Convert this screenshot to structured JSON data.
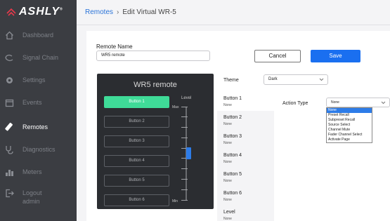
{
  "brand": {
    "name": "ASHLY",
    "reg": "®"
  },
  "sidebar": {
    "items": [
      {
        "label": "Dashboard",
        "icon": "home-icon"
      },
      {
        "label": "Signal Chain",
        "icon": "signal-chain-icon"
      },
      {
        "label": "Settings",
        "icon": "gear-icon"
      },
      {
        "label": "Events",
        "icon": "calendar-icon"
      },
      {
        "label": "Remotes",
        "icon": "remote-icon"
      },
      {
        "label": "Diagnostics",
        "icon": "stethoscope-icon"
      },
      {
        "label": "Meters",
        "icon": "meters-icon"
      },
      {
        "label": "Logout",
        "sub": "admin",
        "icon": "logout-icon"
      }
    ],
    "active": "Remotes"
  },
  "breadcrumb": {
    "parent": "Remotes",
    "separator": "›",
    "current": "Edit Virtual WR-5"
  },
  "form": {
    "remote_name_label": "Remote Name",
    "remote_name_value": "WR5 remote",
    "cancel_label": "Cancel",
    "save_label": "Save",
    "theme_label": "Theme",
    "theme_value": "Dark",
    "action_type_label": "Action Type",
    "action_type_value": "None"
  },
  "preview": {
    "title": "WR5 remote",
    "buttons": [
      "Button 1",
      "Button 2",
      "Button 3",
      "Button 4",
      "Button 5",
      "Button 6"
    ],
    "level_label": "Level",
    "max_label": "Max",
    "min_label": "Min",
    "fader_level": 0.5
  },
  "button_list": [
    {
      "name": "Button 1",
      "action": "None"
    },
    {
      "name": "Button 2",
      "action": "None"
    },
    {
      "name": "Button 3",
      "action": "None"
    },
    {
      "name": "Button 4",
      "action": "None"
    },
    {
      "name": "Button 5",
      "action": "None"
    },
    {
      "name": "Button 6",
      "action": "None"
    },
    {
      "name": "Level",
      "action": "None"
    }
  ],
  "action_options": [
    "None",
    "Preset Recall",
    "Subpreset Recall",
    "Source Select",
    "Channel Mute",
    "Fader Channel Select",
    "Activate Page"
  ],
  "colors": {
    "sidebar_bg": "#3b3d42",
    "accent_blue": "#1a6ff0",
    "selected_green": "#3fdb98",
    "remote_bg": "#2b2d31"
  }
}
